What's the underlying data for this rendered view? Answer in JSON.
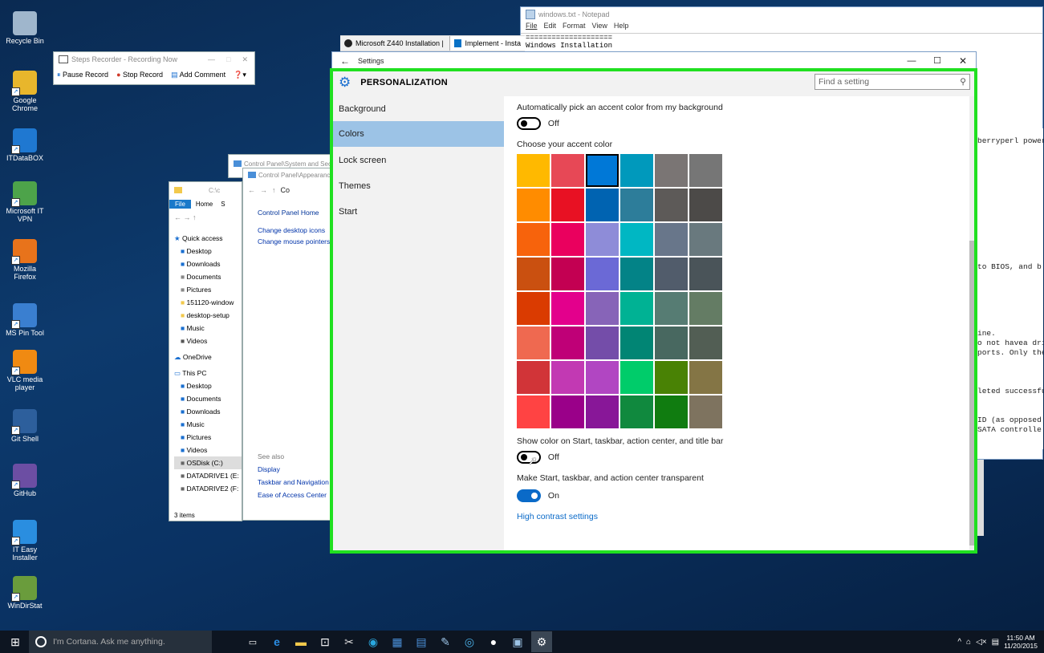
{
  "desktop": {
    "icons": [
      {
        "label": "Recycle Bin",
        "icon": "recycle-bin-icon",
        "color": "#9fb6cc"
      },
      {
        "label": "Google Chrome",
        "icon": "chrome-icon",
        "color": "#e8b62c"
      },
      {
        "label": "ITDataBOX",
        "icon": "itdatabox-icon",
        "color": "#1f78d1"
      },
      {
        "label": "Microsoft IT VPN",
        "icon": "vpn-icon",
        "color": "#4da34a"
      },
      {
        "label": "Mozilla Firefox",
        "icon": "firefox-icon",
        "color": "#e8731b"
      },
      {
        "label": "MS Pin Tool",
        "icon": "pin-tool-icon",
        "color": "#3a7fd0"
      },
      {
        "label": "VLC media player",
        "icon": "vlc-icon",
        "color": "#f08a12"
      },
      {
        "label": "Git Shell",
        "icon": "git-shell-icon",
        "color": "#2d5f9c"
      },
      {
        "label": "GitHub",
        "icon": "github-icon",
        "color": "#6c4ea3"
      },
      {
        "label": "IT Easy Installer",
        "icon": "installer-icon",
        "color": "#2a8ee0"
      },
      {
        "label": "WinDirStat",
        "icon": "windirstat-icon",
        "color": "#6a9c3c"
      }
    ]
  },
  "notepad": {
    "title": "windows.txt - Notepad",
    "menu": [
      "File",
      "Edit",
      "Format",
      "View",
      "Help"
    ],
    "lines": [
      "====================",
      "Windows Installation"
    ],
    "right_lines": [
      "berryperl power",
      "to BIOS, and b",
      "ine.",
      "o not havea dri",
      "ports. Only the",
      "leted successfu",
      "ID (as opposed",
      "SATA controlle"
    ]
  },
  "browser_tabs": [
    {
      "label": "Microsoft Z440 Installation |",
      "icon": "github-icon"
    },
    {
      "label": "Implement - Insta",
      "icon": "sharepoint-icon"
    }
  ],
  "steps_recorder": {
    "title": "Steps Recorder - Recording Now",
    "pause": "Pause Record",
    "stop": "Stop Record",
    "comment": "Add Comment"
  },
  "control_panel": {
    "title1": "Control Panel\\System and Sec",
    "title2": "Control Panel\\Appearanc",
    "address": "Co",
    "home": "Control Panel Home",
    "links": [
      "Change desktop icons",
      "Change mouse pointers"
    ],
    "see_also": "See also",
    "see_also_links": [
      "Display",
      "Taskbar and Navigation",
      "Ease of Access Center"
    ]
  },
  "explorer": {
    "path": "C:\\c",
    "ribbon": [
      "File",
      "Home",
      "S"
    ],
    "quick_access": "Quick access",
    "items": [
      "Desktop",
      "Downloads",
      "Documents",
      "Pictures",
      "151120-window",
      "desktop-setup",
      "Music",
      "Videos"
    ],
    "onedrive": "OneDrive",
    "thispc": "This PC",
    "pc_items": [
      "Desktop",
      "Documents",
      "Downloads",
      "Music",
      "Pictures",
      "Videos",
      "OSDisk (C:)",
      "DATADRIVE1 (E:",
      "DATADRIVE2 (F:"
    ],
    "status": "3 items"
  },
  "settings": {
    "window_title": "Settings",
    "header": "PERSONALIZATION",
    "search_placeholder": "Find a setting",
    "nav": [
      "Background",
      "Colors",
      "Lock screen",
      "Themes",
      "Start"
    ],
    "selected_nav": 1,
    "auto_accent_label": "Automatically pick an accent color from my background",
    "auto_accent_state": "Off",
    "choose_label": "Choose your accent color",
    "show_color_label": "Show color on Start, taskbar, action center, and title bar",
    "show_color_state": "Off",
    "transparent_label": "Make Start, taskbar, and action center transparent",
    "transparent_state": "On",
    "high_contrast": "High contrast settings",
    "selected_swatch": 2,
    "swatches": [
      "#FFB900",
      "#E74856",
      "#0078D7",
      "#0099BC",
      "#7A7574",
      "#767676",
      "#FF8C00",
      "#E81123",
      "#0063B1",
      "#2D7D9A",
      "#5D5A58",
      "#4C4A48",
      "#F7630C",
      "#EA005E",
      "#8E8CD8",
      "#00B7C3",
      "#68768A",
      "#69797E",
      "#CA5010",
      "#C30052",
      "#6B69D6",
      "#038387",
      "#515C6B",
      "#4A5459",
      "#DA3B01",
      "#E3008C",
      "#8764B8",
      "#00B294",
      "#567C73",
      "#647C64",
      "#EF6950",
      "#BF0077",
      "#744DA9",
      "#018574",
      "#486860",
      "#525E54",
      "#D13438",
      "#C239B3",
      "#B146C2",
      "#00CC6A",
      "#498205",
      "#847545",
      "#FF4343",
      "#9A0089",
      "#881798",
      "#10893E",
      "#107C10",
      "#7E735F"
    ]
  },
  "taskbar": {
    "search": "I'm Cortana. Ask me anything.",
    "time": "11:50 AM",
    "date": "11/20/2015"
  },
  "colors": {
    "accent": "#0078D7",
    "highlight_frame": "#20E020",
    "selected_nav_bg": "#9CC3E6"
  }
}
